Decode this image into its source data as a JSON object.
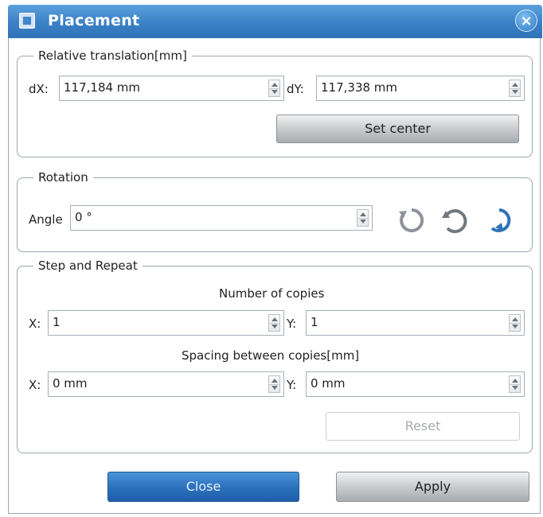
{
  "window": {
    "title": "Placement",
    "close_glyph": "×"
  },
  "relative_translation": {
    "legend": "Relative translation[mm]",
    "dx_label": "dX:",
    "dx_value": "117,184 mm",
    "dy_label": "dY:",
    "dy_value": "117,338 mm",
    "set_center_label": "Set center"
  },
  "rotation": {
    "legend": "Rotation",
    "angle_label": "Angle",
    "angle_value": "0 °",
    "icons": [
      "rotate-ccw-icon",
      "rotate-reverse-icon",
      "rotate-cw-icon"
    ]
  },
  "step_repeat": {
    "legend": "Step and Repeat",
    "copies_heading": "Number of copies",
    "copies_x_label": "X:",
    "copies_x_value": "1",
    "copies_y_label": "Y:",
    "copies_y_value": "1",
    "spacing_heading": "Spacing between copies[mm]",
    "spacing_x_label": "X:",
    "spacing_x_value": "0 mm",
    "spacing_y_label": "Y:",
    "spacing_y_value": "0 mm",
    "reset_label": "Reset"
  },
  "footer": {
    "close_label": "Close",
    "apply_label": "Apply"
  },
  "colors": {
    "titlebar": "#3b80c6",
    "accent_icon": "#2f72b8",
    "close_button": "#2d72be"
  }
}
